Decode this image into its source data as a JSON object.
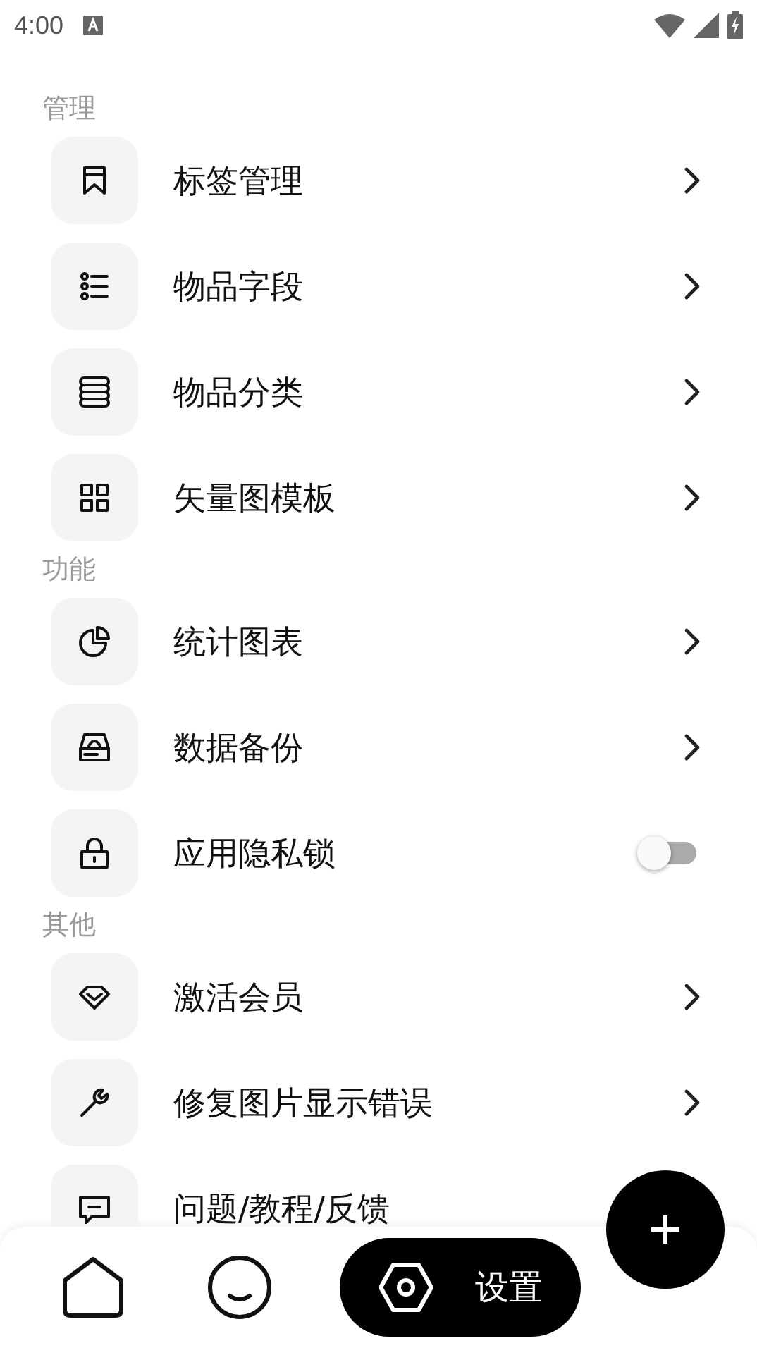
{
  "status_bar": {
    "time": "4:00"
  },
  "sections": [
    {
      "title": "管理",
      "items": [
        {
          "label": "标签管理",
          "kind": "link"
        },
        {
          "label": "物品字段",
          "kind": "link"
        },
        {
          "label": "物品分类",
          "kind": "link"
        },
        {
          "label": "矢量图模板",
          "kind": "link"
        }
      ]
    },
    {
      "title": "功能",
      "items": [
        {
          "label": "统计图表",
          "kind": "link"
        },
        {
          "label": "数据备份",
          "kind": "link"
        },
        {
          "label": "应用隐私锁",
          "kind": "toggle",
          "on": false
        }
      ]
    },
    {
      "title": "其他",
      "items": [
        {
          "label": "激活会员",
          "kind": "link"
        },
        {
          "label": "修复图片显示错误",
          "kind": "link"
        },
        {
          "label": "问题/教程/反馈",
          "kind": "plain"
        }
      ]
    }
  ],
  "bottom_nav": [
    {
      "selected": false
    },
    {
      "selected": false
    },
    {
      "label": "设置",
      "selected": true
    }
  ]
}
